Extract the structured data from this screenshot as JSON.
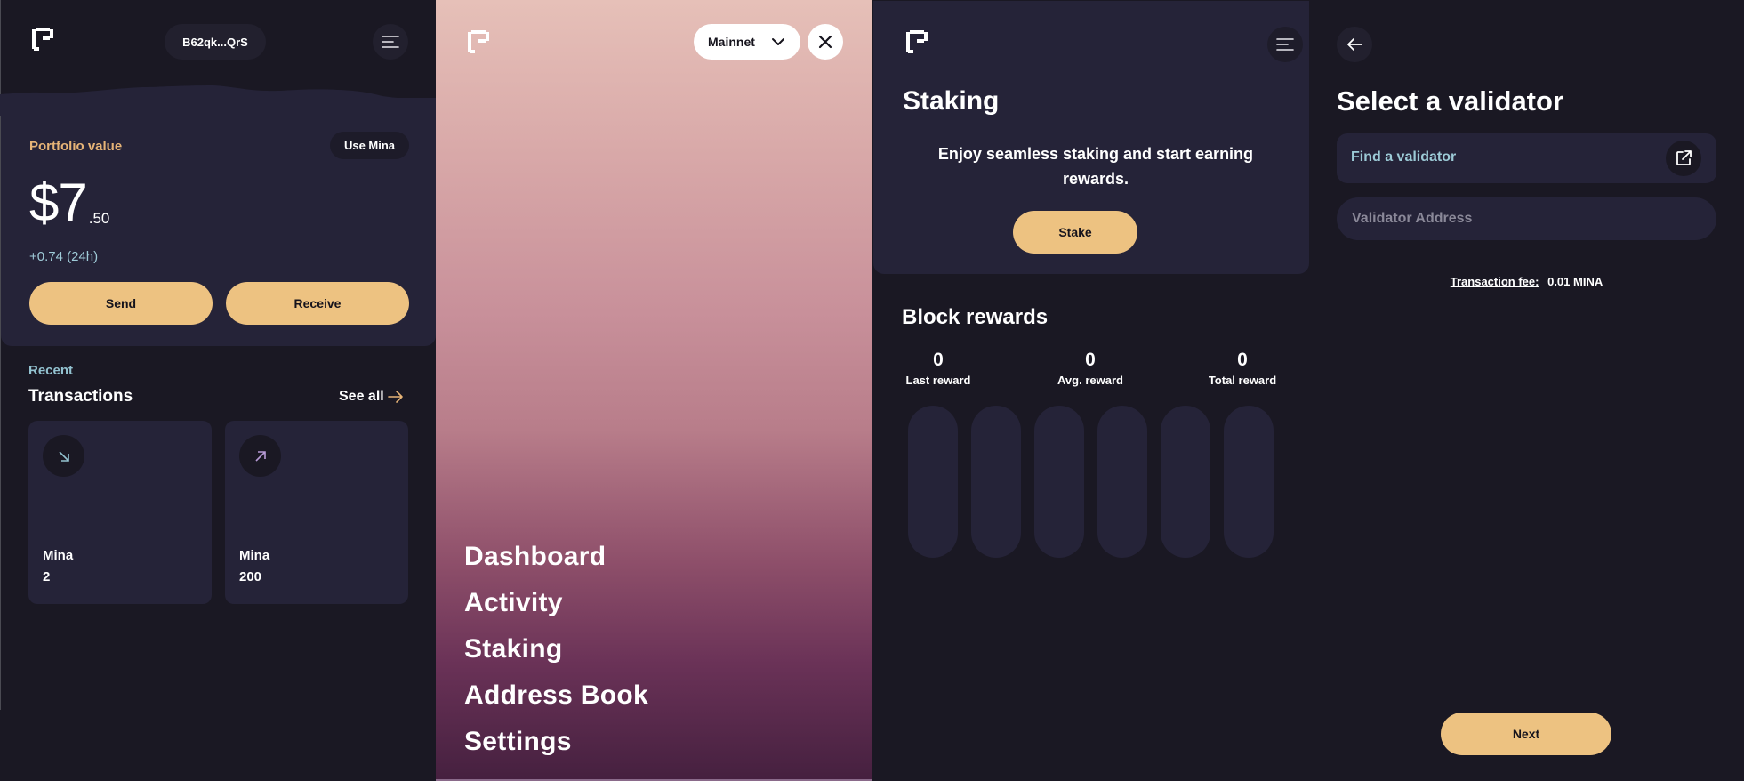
{
  "colors": {
    "background": "#1a1823",
    "card": "#252338",
    "accent": "#edc281",
    "accent_text": "#e7b477",
    "teal_text": "#9fcbd8",
    "incoming_icon": "#93c2d0",
    "outgoing_icon": "#b79bd6"
  },
  "dashboard": {
    "address": "B62qk...QrS",
    "portfolio_label": "Portfolio value",
    "use_mina_label": "Use Mina",
    "balance_main": "$7",
    "balance_cents": ".50",
    "change": "+0.74 (24h)",
    "send_label": "Send",
    "receive_label": "Receive",
    "recent_label": "Recent",
    "transactions_title": "Transactions",
    "see_all_label": "See all",
    "transactions": [
      {
        "direction": "incoming",
        "icon": "arrow-down-right-icon",
        "asset": "Mina",
        "amount": "2"
      },
      {
        "direction": "outgoing",
        "icon": "arrow-up-right-icon",
        "asset": "Mina",
        "amount": "200"
      }
    ]
  },
  "menu": {
    "network": "Mainnet",
    "items": [
      {
        "label": "Dashboard"
      },
      {
        "label": "Activity"
      },
      {
        "label": "Staking"
      },
      {
        "label": "Address Book"
      },
      {
        "label": "Settings"
      }
    ]
  },
  "staking": {
    "title": "Staking",
    "description": "Enjoy seamless staking and start earning rewards.",
    "stake_label": "Stake",
    "block_rewards_title": "Block rewards",
    "stats": [
      {
        "value": "0",
        "label": "Last reward"
      },
      {
        "value": "0",
        "label": "Avg. reward"
      },
      {
        "value": "0",
        "label": "Total reward"
      }
    ],
    "reward_bars": [
      0,
      0,
      0,
      0,
      0,
      0
    ]
  },
  "validator": {
    "title": "Select a validator",
    "find_label": "Find a validator",
    "address_placeholder": "Validator Address",
    "address_value": "",
    "fee_label": "Transaction fee:",
    "fee_value": "0.01 MINA",
    "next_label": "Next"
  }
}
